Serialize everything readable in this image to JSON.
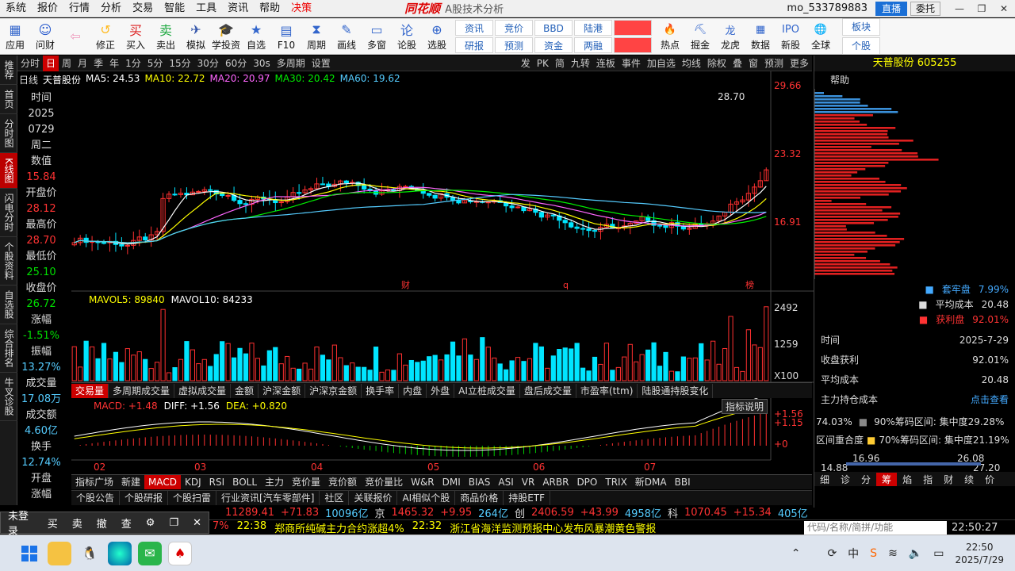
{
  "menubar": {
    "items": [
      "系统",
      "报价",
      "行情",
      "分析",
      "交易",
      "智能",
      "工具",
      "资讯",
      "帮助",
      "决策"
    ],
    "logo": "同花顺",
    "app_title": "A股技术分析",
    "user": "mo_533789883",
    "live": "直播",
    "entrust": "委托"
  },
  "toolbar": {
    "buttons": [
      "应用",
      "问财",
      "",
      "修正",
      "买入",
      "卖出",
      "模拟",
      "学投资",
      "自选",
      "F10",
      "周期",
      "画线",
      "多窗",
      "论股",
      "选股"
    ],
    "grid": [
      "资讯",
      "竞价",
      "BBD",
      "陆港",
      "",
      "研报",
      "预测",
      "资金",
      "两融",
      ""
    ],
    "right": [
      "热点",
      "掘金",
      "龙虎",
      "数据",
      "新股",
      "全球"
    ],
    "extra": [
      "板块",
      "个股"
    ]
  },
  "leftbar": [
    "推荐",
    "首页",
    "分时图",
    "K线图",
    "闪电分时",
    "个股资料",
    "自选股",
    "综合排名",
    "牛叉诊股"
  ],
  "periodbar": {
    "items": [
      "分时",
      "日",
      "周",
      "月",
      "季",
      "年",
      "1分",
      "5分",
      "15分",
      "30分",
      "60分",
      "30s",
      "多周期",
      "设置"
    ],
    "right": [
      "发",
      "PK",
      "简",
      "九转",
      "连板",
      "事件",
      "加自选",
      "均线",
      "除权",
      "叠",
      "窗",
      "预测",
      "更多"
    ]
  },
  "kline": {
    "label": "日线",
    "name": "天普股份",
    "ma5": "MA5: 24.53",
    "ma10": "MA10: 22.72",
    "ma20": "MA20: 20.97",
    "ma30": "MA30: 20.42",
    "ma60": "MA60: 19.62",
    "high_label": "28.70",
    "y_ticks": [
      "29.66",
      "23.32",
      "16.91"
    ],
    "marks": [
      "财",
      "q",
      "榜"
    ]
  },
  "volume": {
    "label": "MAVOL5: 89840",
    "label2": "MAVOL10: 84233",
    "y_ticks": [
      "2492",
      "1259",
      "X100"
    ]
  },
  "macd": {
    "label": "MACD: +1.48",
    "diff": "DIFF: +1.56",
    "dea": "DEA: +0.820",
    "y_ticks": [
      "+1.56",
      "+1.15",
      "+0"
    ],
    "months": [
      "02",
      "03",
      "04",
      "05",
      "06",
      "07"
    ],
    "help": "指标说明"
  },
  "info": {
    "items": [
      {
        "l": "时间"
      },
      {
        "l": "2025"
      },
      {
        "l": "0729"
      },
      {
        "l": "周二"
      },
      {
        "l": "数值"
      },
      {
        "l": "15.84",
        "c": "#f33"
      },
      {
        "l": "开盘价"
      },
      {
        "l": "28.12",
        "c": "#f33"
      },
      {
        "l": "最高价"
      },
      {
        "l": "28.70",
        "c": "#f33"
      },
      {
        "l": "最低价"
      },
      {
        "l": "25.10",
        "c": "#0d0"
      },
      {
        "l": "收盘价"
      },
      {
        "l": "26.72",
        "c": "#0d0"
      },
      {
        "l": "涨幅"
      },
      {
        "l": "-1.51%",
        "c": "#0d0"
      },
      {
        "l": "振幅"
      },
      {
        "l": "13.27%",
        "c": "#5cf"
      },
      {
        "l": "成交量"
      },
      {
        "l": "17.08万",
        "c": "#5cf"
      },
      {
        "l": "成交额"
      },
      {
        "l": "4.60亿",
        "c": "#5cf"
      },
      {
        "l": "换手"
      },
      {
        "l": "12.74%",
        "c": "#5cf"
      },
      {
        "l": "开盘"
      },
      {
        "l": "涨幅"
      }
    ]
  },
  "tabs1": [
    "交易量",
    "多周期成交量",
    "虚拟成交量",
    "金额",
    "沪深金额",
    "沪深京金额",
    "换手率",
    "内盘",
    "外盘",
    "AI立桩成交量",
    "盘后成交量",
    "市盈率(ttm)",
    "陆股通持股变化"
  ],
  "tabs2": [
    "指标广场",
    "新建",
    "MACD",
    "KDJ",
    "RSI",
    "BOLL",
    "主力",
    "竞价量",
    "竞价额",
    "竞价量比",
    "W&R",
    "DMI",
    "BIAS",
    "ASI",
    "VR",
    "ARBR",
    "DPO",
    "TRIX",
    "新DMA",
    "BBI"
  ],
  "tabs3": [
    "个股公告",
    "个股研报",
    "个股扫雷",
    "行业资讯[汽车零部件]",
    "社区",
    "关联报价",
    "AI相似个股",
    "商品价格",
    "持股ETF"
  ],
  "right": {
    "title": "天普股份 605255",
    "help": "帮助",
    "legend": [
      {
        "k": "套牢盘",
        "v": "7.99%",
        "c": "#4af"
      },
      {
        "k": "平均成本",
        "v": "20.48",
        "c": "#ddd"
      },
      {
        "k": "获利盘",
        "v": "92.01%",
        "c": "#f33"
      }
    ],
    "rows": [
      {
        "k": "时间",
        "v": "2025-7-29"
      },
      {
        "k": "收盘获利",
        "v": "92.01%"
      },
      {
        "k": "平均成本",
        "v": "20.48"
      },
      {
        "k": "主力持仓成本",
        "v": "点击查看"
      }
    ],
    "conc90": "90%筹码区间: 集中度29.28%",
    "conc90pct": "74.03%",
    "conc70": "70%筹码区间: 集中度21.19%",
    "overlap": "区间重合度",
    "low": "14.88",
    "v1": "16.96",
    "v2": "26.08",
    "high": "27.20",
    "bottom_tabs": [
      "细",
      "诊",
      "分",
      "筹",
      "焰",
      "指",
      "财",
      "续",
      "价"
    ]
  },
  "ticker": [
    {
      "t": "11289.41",
      "c": "#f33"
    },
    {
      "t": "+71.83",
      "c": "#f33"
    },
    {
      "t": "10096亿",
      "c": "#5cf"
    },
    {
      "t": "京",
      "c": "#ddd"
    },
    {
      "t": "1465.32",
      "c": "#f33"
    },
    {
      "t": "+9.95",
      "c": "#f33"
    },
    {
      "t": "264亿",
      "c": "#5cf"
    },
    {
      "t": "创",
      "c": "#ddd"
    },
    {
      "t": "2406.59",
      "c": "#f33"
    },
    {
      "t": "+43.99",
      "c": "#f33"
    },
    {
      "t": "4958亿",
      "c": "#5cf"
    },
    {
      "t": "科",
      "c": "#ddd"
    },
    {
      "t": "1070.45",
      "c": "#f33"
    },
    {
      "t": "+15.34",
      "c": "#f33"
    },
    {
      "t": "405亿",
      "c": "#5cf"
    }
  ],
  "news": [
    {
      "t": "7%",
      "c": "#f33"
    },
    {
      "t": "22:38",
      "c": "#ff0"
    },
    {
      "t": "郑商所纯碱主力合约涨超4%",
      "c": "#ff0"
    },
    {
      "t": "22:32",
      "c": "#ff0"
    },
    {
      "t": "浙江省海洋监测预报中心发布风暴潮黄色警报",
      "c": "#ff0"
    }
  ],
  "search_placeholder": "代码/名称/简拼/功能",
  "clock": "22:50:27",
  "popup": [
    "未登录",
    "买",
    "卖",
    "撤",
    "查"
  ],
  "taskbar": {
    "time": "22:50",
    "date": "2025/7/29"
  },
  "colors": {
    "up": "#ff3030",
    "down": "#00e5ff",
    "accent": "#c00"
  }
}
